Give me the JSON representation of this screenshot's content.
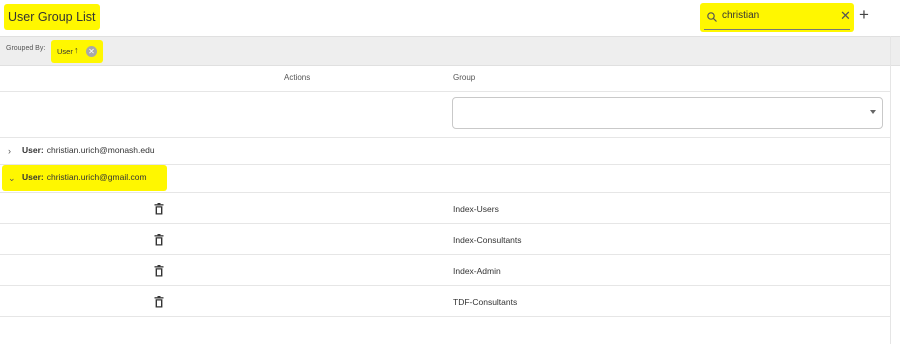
{
  "header": {
    "title": "User Group List",
    "search_value": "christian",
    "clear_symbol": "✕",
    "add_symbol": "+"
  },
  "groupbar": {
    "label": "Grouped By:",
    "chip": {
      "label": "User",
      "sort_arrow": "↑",
      "remove_symbol": "✕"
    }
  },
  "columns": {
    "actions": "Actions",
    "group": "Group"
  },
  "filter": {
    "group_select_value": ""
  },
  "groups": [
    {
      "field": "User:",
      "value": "christian.urich@monash.edu",
      "expanded": false,
      "chevron": "›"
    },
    {
      "field": "User:",
      "value": "christian.urich@gmail.com",
      "expanded": true,
      "chevron": "⌄"
    }
  ],
  "rows": [
    {
      "group": "Index-Users"
    },
    {
      "group": "Index-Consultants"
    },
    {
      "group": "Index-Admin"
    },
    {
      "group": "TDF-Consultants"
    }
  ],
  "colors": {
    "highlight": "#fff700",
    "groupbar_bg": "#eeeeee"
  }
}
